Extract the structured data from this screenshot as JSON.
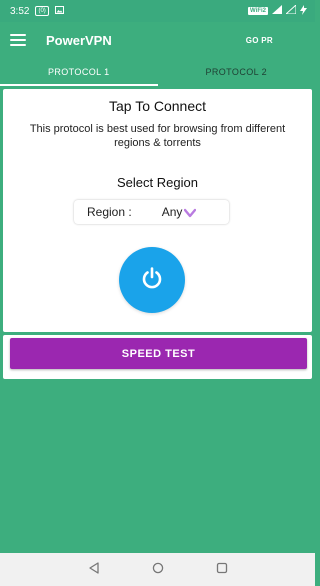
{
  "status_bar": {
    "time": "3:52",
    "badge": "(0)",
    "wifi_label": "WiFi2"
  },
  "app_bar": {
    "title": "PowerVPN",
    "gopro_label": "GO PR"
  },
  "tabs": [
    {
      "label": "PROTOCOL 1",
      "selected": true
    },
    {
      "label": "PROTOCOL 2",
      "selected": false
    }
  ],
  "connect_card": {
    "title": "Tap To Connect",
    "description": "This protocol is best used for browsing from different regions & torrents",
    "select_region_title": "Select Region",
    "region_label": "Region :",
    "region_value": "Any",
    "power_icon": "power-icon"
  },
  "speed_test": {
    "label": "SPEED TEST"
  },
  "colors": {
    "primary_green": "#3dae7e",
    "power_blue": "#1aa3ea",
    "speed_purple": "#9b27b0",
    "chevron_purple": "#b97be0"
  },
  "icons": {
    "menu": "hamburger-menu-icon",
    "back": "back-triangle-icon",
    "home": "home-circle-icon",
    "recents": "recents-square-icon"
  }
}
